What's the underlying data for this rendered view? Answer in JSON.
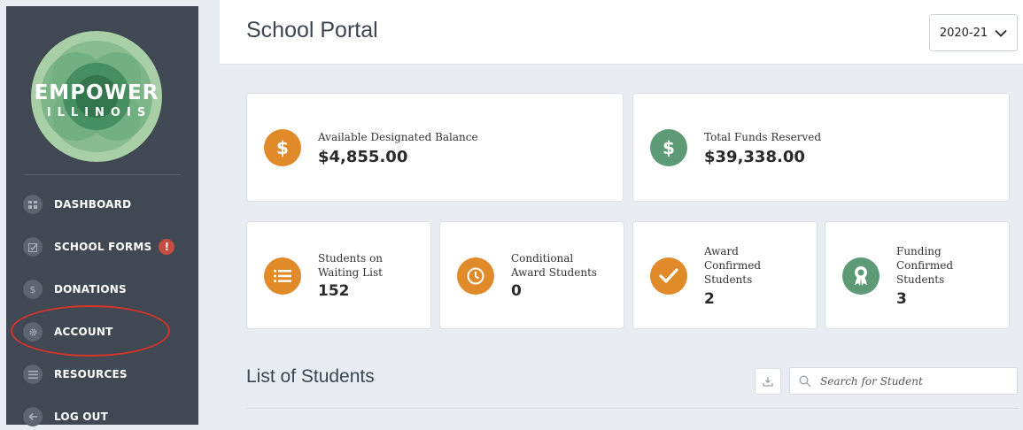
{
  "sidebar": {
    "logo_line1": "EMPOWER",
    "logo_line2": "ILLINOIS",
    "items": [
      {
        "label": "DASHBOARD",
        "icon": "dashboard-grid-icon"
      },
      {
        "label": "SCHOOL FORMS",
        "icon": "checkbox-icon",
        "badge": "!"
      },
      {
        "label": "DONATIONS",
        "icon": "dollar-icon",
        "glyph": "$"
      },
      {
        "label": "ACCOUNT",
        "icon": "gear-icon"
      },
      {
        "label": "RESOURCES",
        "icon": "list-icon"
      },
      {
        "label": "LOG OUT",
        "icon": "arrow-left-icon"
      }
    ]
  },
  "header": {
    "title": "School Portal",
    "year": "2020-21"
  },
  "cards": {
    "available_balance": {
      "label": "Available Designated Balance",
      "value": "$4,855.00",
      "icon_glyph": "$"
    },
    "total_reserved": {
      "label": "Total Funds Reserved",
      "value": "$39,338.00",
      "icon_glyph": "$"
    },
    "waiting_list": {
      "label_line1": "Students on",
      "label_line2": "Waiting List",
      "value": "152"
    },
    "conditional": {
      "label_line1": "Conditional",
      "label_line2": "Award Students",
      "value": "0"
    },
    "award_confirmed": {
      "label_line1": "Award",
      "label_line2": "Confirmed",
      "label_line3": "Students",
      "value": "2"
    },
    "funding_confirmed": {
      "label_line1": "Funding",
      "label_line2": "Confirmed",
      "label_line3": "Students",
      "value": "3"
    }
  },
  "list": {
    "title": "List of Students",
    "search_placeholder": "Search for Student"
  },
  "colors": {
    "sidebar_bg": "#3f4853",
    "accent_orange": "#e08a2a",
    "accent_green": "#5d9a76",
    "alert_red": "#c44d3f",
    "annotation_red": "#d6332b"
  }
}
